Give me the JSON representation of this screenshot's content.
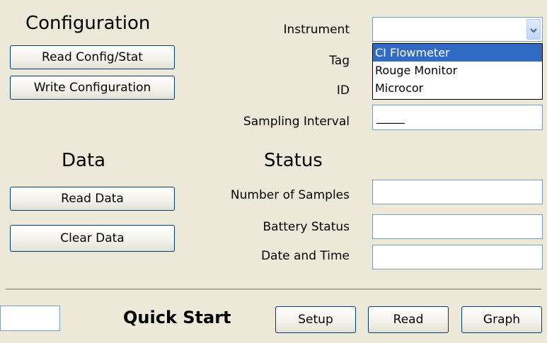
{
  "config": {
    "heading": "Configuration",
    "read_btn": "Read Config/Stat",
    "write_btn": "Write Configuration"
  },
  "fields": {
    "instrument_label": "Instrument",
    "tag_label": "Tag",
    "id_label": "ID",
    "sampling_label": "Sampling Interval",
    "sampling_value": "_____"
  },
  "instrument_dropdown": {
    "selected_value": "",
    "options": [
      "CI Flowmeter",
      "Rouge Monitor",
      "Microcor"
    ],
    "highlighted_index": 0
  },
  "data_section": {
    "heading": "Data",
    "read_btn": "Read Data",
    "clear_btn": "Clear Data"
  },
  "status": {
    "heading": "Status",
    "samples_label": "Number of Samples",
    "battery_label": "Battery Status",
    "datetime_label": "Date and Time",
    "samples_value": "",
    "battery_value": "",
    "datetime_value": ""
  },
  "quick_start": {
    "heading": "Quick Start",
    "setup_btn": "Setup",
    "read_btn": "Read",
    "graph_btn": "Graph",
    "input_value": ""
  },
  "icons": {
    "dropdown_arrow": "chevron-down-icon"
  },
  "colors": {
    "background": "#ece9d8",
    "selection": "#316ac5",
    "button_border": "#003c74"
  }
}
